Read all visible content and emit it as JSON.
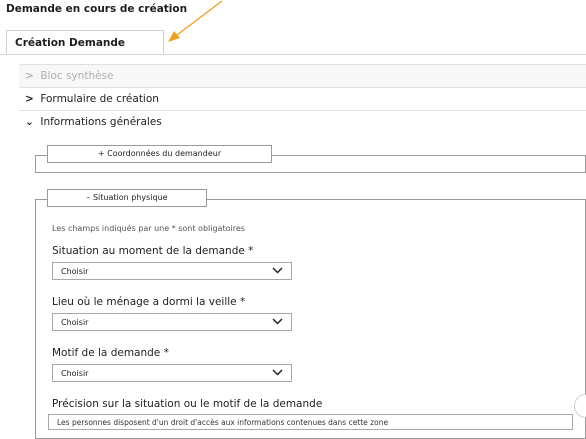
{
  "page_title": "Demande en cours de création",
  "tab": {
    "label": "Création Demande"
  },
  "accordion": {
    "synthese": {
      "label": "Bloc synthèse",
      "chevron": ">"
    },
    "formulaire": {
      "label": "Formulaire de création",
      "chevron": ">"
    },
    "infos": {
      "label": "Informations générales",
      "chevron": "⌄"
    }
  },
  "coordonnees": {
    "label": "+ Coordonnées du demandeur"
  },
  "situation_physique": {
    "label": "– Situation physique"
  },
  "required_note": "Les champs indiqués par une * sont obligatoires",
  "fields": {
    "situation": {
      "label": "Situation au moment de la demande *",
      "value": "Choisir"
    },
    "lieu": {
      "label": "Lieu où le ménage a dormi la veille *",
      "value": "Choisir"
    },
    "motif": {
      "label": "Motif de la demande *",
      "value": "Choisir"
    },
    "precision": {
      "label": "Précision sur la situation ou le motif de la demande",
      "value": "Les personnes disposent d'un droit d'accès aux informations contenues dans cette zone"
    }
  },
  "colors": {
    "annotation_arrow": "#f0a020",
    "border": "#9a9a9a"
  }
}
